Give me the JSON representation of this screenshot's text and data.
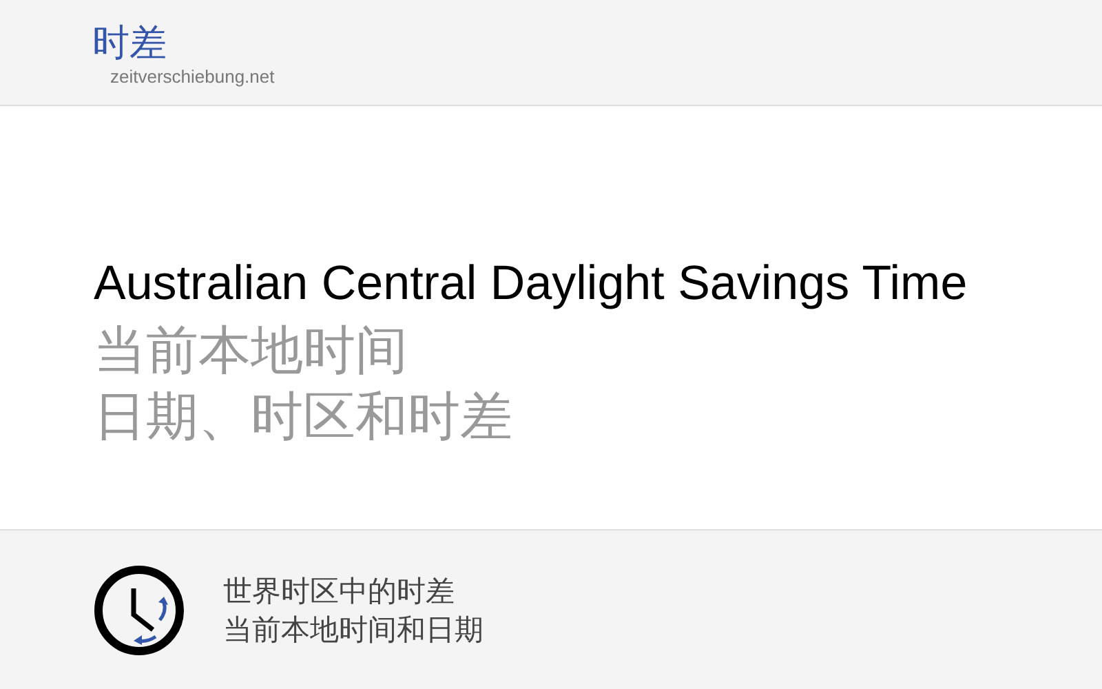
{
  "header": {
    "logo": "时差",
    "domain": "zeitverschiebung.net"
  },
  "main": {
    "title": "Australian Central Daylight Savings Time",
    "subtitle_lines": [
      "当前本地时间",
      "日期、时区和时差"
    ]
  },
  "footer": {
    "lines": [
      "世界时区中的时差",
      "当前本地时间和日期"
    ]
  }
}
